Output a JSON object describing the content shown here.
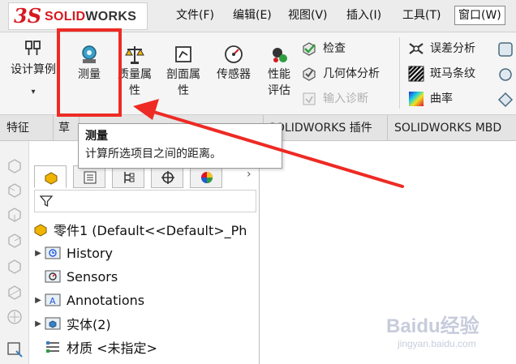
{
  "app": {
    "brand_ds": "3S",
    "brand_solid": "SOLID",
    "brand_works": "WORKS"
  },
  "menu": {
    "file": "文件(F)",
    "edit": "编辑(E)",
    "view": "视图(V)",
    "insert": "插入(I)",
    "tools": "工具(T)",
    "window": "窗口(W)"
  },
  "ribbon": {
    "design_study": "设计算例",
    "measure": "测量",
    "mass_props_1": "质量属",
    "mass_props_2": "性",
    "section_props_1": "剖面属",
    "section_props_2": "性",
    "sensor": "传感器",
    "perf_eval_1": "性能",
    "perf_eval_2": "评估",
    "check": "检查",
    "geometry_analysis": "几何体分析",
    "import_diagnostics": "输入诊断",
    "deviation_analysis": "误差分析",
    "zebra_stripes": "斑马条纹",
    "curvature": "曲率",
    "dropdown_arrow": "▾"
  },
  "tabs": {
    "features": "特征",
    "sketch": "草",
    "addins": "SOLIDWORKS 插件",
    "mbd": "SOLIDWORKS MBD"
  },
  "tooltip": {
    "title": "测量",
    "description": "计算所选项目之间的距离。"
  },
  "featuretree": {
    "chevron": "›",
    "part_label": "零件1  (Default<<Default>_Ph",
    "items": [
      {
        "label": "History",
        "expandable": true
      },
      {
        "label": "Sensors",
        "expandable": false
      },
      {
        "label": "Annotations",
        "expandable": true
      },
      {
        "label": "实体(2)",
        "expandable": true
      },
      {
        "label": "材质 <未指定>",
        "expandable": false
      }
    ]
  },
  "watermark": {
    "main": "Baidu经验",
    "sub": "jingyan.baidu.com"
  },
  "colors": {
    "highlight": "#ee2a24",
    "brand_red": "#d71920"
  }
}
